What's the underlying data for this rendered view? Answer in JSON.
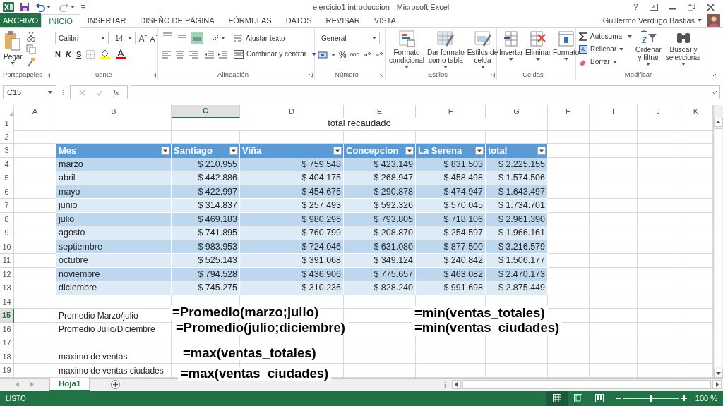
{
  "title_bar": {
    "title": "ejercicio1 introduccion - Microsoft Excel",
    "help": "?"
  },
  "tabs": [
    {
      "label": "ARCHIVO",
      "kind": "file",
      "selected": false
    },
    {
      "label": "INICIO",
      "kind": "tab",
      "selected": true
    },
    {
      "label": "INSERTAR",
      "kind": "tab",
      "selected": false
    },
    {
      "label": "DISEÑO DE PÁGINA",
      "kind": "tab",
      "selected": false
    },
    {
      "label": "FÓRMULAS",
      "kind": "tab",
      "selected": false
    },
    {
      "label": "DATOS",
      "kind": "tab",
      "selected": false
    },
    {
      "label": "REVISAR",
      "kind": "tab",
      "selected": false
    },
    {
      "label": "VISTA",
      "kind": "tab",
      "selected": false
    }
  ],
  "account": {
    "user": "Guillermo Verdugo Bastias"
  },
  "ribbon": {
    "clipboard": {
      "paste": "Pegar",
      "label": "Portapapeles"
    },
    "font": {
      "name": "Calibri",
      "size": "14",
      "styles": [
        "N",
        "K",
        "S"
      ],
      "label": "Fuente"
    },
    "alignment": {
      "vertical": [
        {
          "selected": false
        },
        {
          "selected": false
        },
        {
          "selected": true
        }
      ],
      "wrap": "Ajustar texto",
      "merge": "Combinar y centrar",
      "label": "Alineación"
    },
    "number": {
      "format": "General",
      "percent": "%",
      "thousands": "000",
      "label": "Número"
    },
    "styles": {
      "buttons": [
        "Formato\ncondicional",
        "Dar formato\ncomo tabla",
        "Estilos de\ncelda"
      ],
      "label": "Estilos"
    },
    "cells": {
      "buttons": [
        "Insertar",
        "Eliminar",
        "Formato"
      ],
      "label": "Celdas"
    },
    "editing": {
      "autosum": "Autosuma",
      "fill": "Rellenar",
      "clear": "Borrar",
      "buttons": [
        "Ordenar\ny filtrar",
        "Buscar y\nseleccionar"
      ],
      "label": "Modificar"
    }
  },
  "name_box": "C15",
  "fx": "fx",
  "columns": [
    {
      "label": "A",
      "selected": false
    },
    {
      "label": "B",
      "selected": false
    },
    {
      "label": "C",
      "selected": true
    },
    {
      "label": "D",
      "selected": false
    },
    {
      "label": "E",
      "selected": false
    },
    {
      "label": "F",
      "selected": false
    },
    {
      "label": "G",
      "selected": false
    },
    {
      "label": "H",
      "selected": false
    },
    {
      "label": "I",
      "selected": false
    },
    {
      "label": "J",
      "selected": false
    },
    {
      "label": "K",
      "selected": false
    }
  ],
  "rows": [
    {
      "number": "1",
      "kind": "title",
      "selected": false,
      "title": "total recaudado"
    },
    {
      "number": "2",
      "kind": "blank",
      "selected": false
    },
    {
      "number": "3",
      "kind": "header",
      "selected": false,
      "cells": [
        "Mes",
        "Santiago",
        "Viña",
        "Concepcion",
        "La Serena",
        "total"
      ]
    },
    {
      "number": "4",
      "kind": "data",
      "selected": false,
      "cells": [
        "marzo",
        "$ 210.955",
        "$ 759.548",
        "$ 423.149",
        "$ 831.503",
        "$ 2.225.155"
      ]
    },
    {
      "number": "5",
      "kind": "data",
      "selected": false,
      "cells": [
        "abril",
        "$ 442.886",
        "$ 404.175",
        "$ 268.947",
        "$ 458.498",
        "$ 1.574.506"
      ]
    },
    {
      "number": "6",
      "kind": "data",
      "selected": false,
      "cells": [
        "mayo",
        "$ 422.997",
        "$ 454.675",
        "$ 290.878",
        "$ 474.947",
        "$ 1.643.497"
      ]
    },
    {
      "number": "7",
      "kind": "data",
      "selected": false,
      "cells": [
        "junio",
        "$ 314.837",
        "$ 257.493",
        "$ 592.326",
        "$ 570.045",
        "$ 1.734.701"
      ]
    },
    {
      "number": "8",
      "kind": "data",
      "selected": false,
      "cells": [
        "julio",
        "$ 469.183",
        "$ 980.296",
        "$ 793.805",
        "$ 718.106",
        "$ 2.961.390"
      ]
    },
    {
      "number": "9",
      "kind": "data",
      "selected": false,
      "cells": [
        "agosto",
        "$ 741.895",
        "$ 760.799",
        "$ 208.870",
        "$ 254.597",
        "$ 1.966.161"
      ]
    },
    {
      "number": "10",
      "kind": "data",
      "selected": false,
      "cells": [
        "septiembre",
        "$ 983.953",
        "$ 724.046",
        "$ 631.080",
        "$ 877.500",
        "$ 3.216.579"
      ]
    },
    {
      "number": "11",
      "kind": "data",
      "selected": false,
      "cells": [
        "octubre",
        "$ 525.143",
        "$ 391.068",
        "$ 349.124",
        "$ 240.842",
        "$ 1.506.177"
      ]
    },
    {
      "number": "12",
      "kind": "data",
      "selected": false,
      "cells": [
        "noviembre",
        "$ 794.528",
        "$ 436.906",
        "$ 775.657",
        "$ 463.082",
        "$ 2.470.173"
      ]
    },
    {
      "number": "13",
      "kind": "data",
      "selected": false,
      "cells": [
        "diciembre",
        "$ 745.275",
        "$ 310.236",
        "$ 828.240",
        "$ 991.698",
        "$ 2.875.449"
      ]
    },
    {
      "number": "14",
      "kind": "blank",
      "selected": false
    },
    {
      "number": "15",
      "kind": "label",
      "selected": true,
      "text": "Promedio Marzo/julio"
    },
    {
      "number": "16",
      "kind": "label",
      "selected": false,
      "text": "Promedio Julio/Diciembre"
    },
    {
      "number": "17",
      "kind": "blank",
      "selected": false
    },
    {
      "number": "18",
      "kind": "label",
      "selected": false,
      "text": "maximo de ventas"
    },
    {
      "number": "19",
      "kind": "label",
      "selected": false,
      "text": "maximo de ventas ciudades"
    }
  ],
  "annotations": [
    "=Promedio(marzo;julio)",
    "=Promedio(julio;diciembre)",
    "=max(ventas_totales)",
    "=max(ventas_ciudades)",
    "=min(ventas_totales)",
    "=min(ventas_ciudades)"
  ],
  "sheets": [
    {
      "label": "Hoja1",
      "selected": true
    }
  ],
  "status": {
    "text": "LISTO",
    "zoom": {
      "level": 0.5,
      "reading": "100 %"
    }
  }
}
